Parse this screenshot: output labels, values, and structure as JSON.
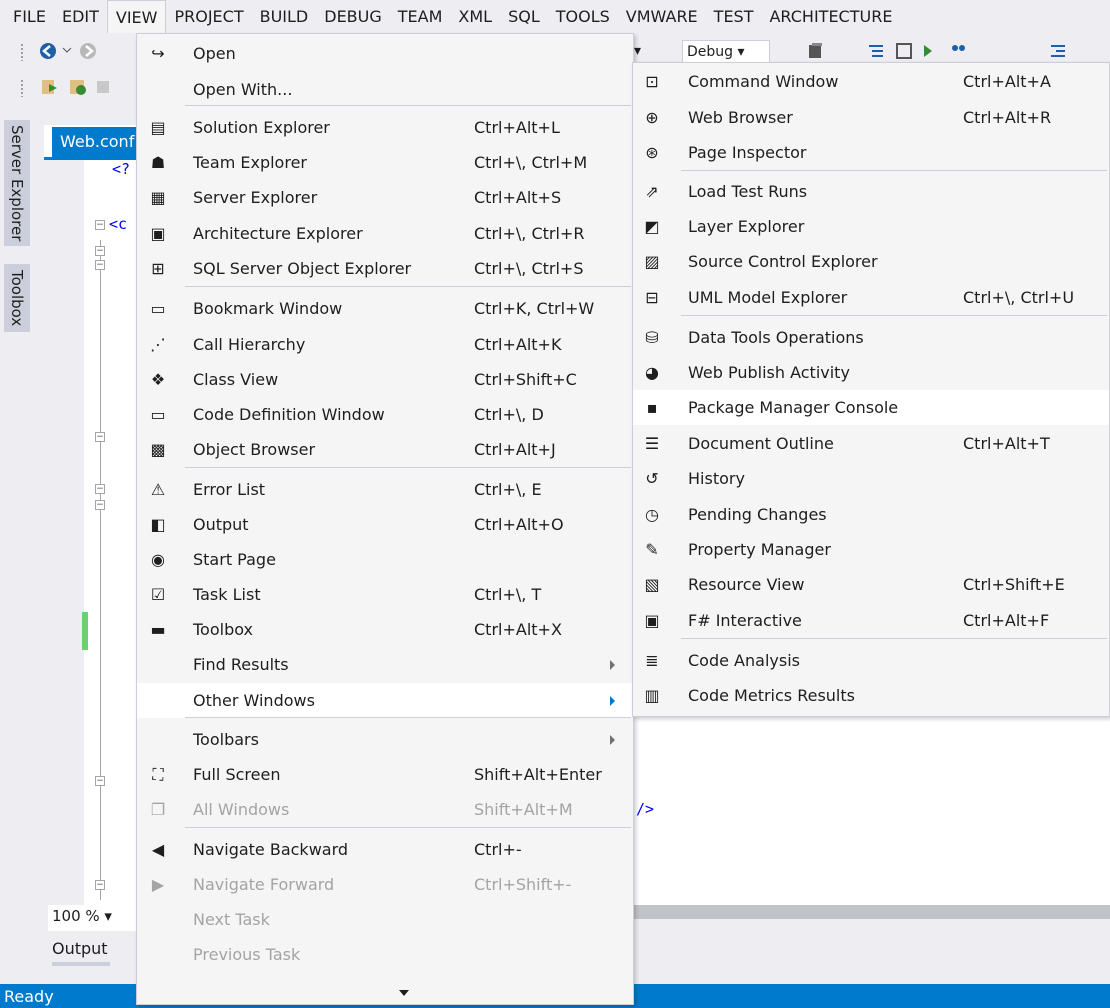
{
  "menubar": {
    "items": [
      "FILE",
      "EDIT",
      "VIEW",
      "PROJECT",
      "BUILD",
      "DEBUG",
      "TEAM",
      "XML",
      "SQL",
      "TOOLS",
      "VMWARE",
      "TEST",
      "ARCHITECTURE"
    ],
    "open_item": "VIEW"
  },
  "toolbar": {
    "config_value": "Debug"
  },
  "side_tabs": {
    "server_explorer": "Server Explorer",
    "toolbox": "Toolbox"
  },
  "editor": {
    "doc_tab": "Web.conf",
    "code_fragments": [
      "<?",
      "<c",
      "/>"
    ],
    "zoom": "100 %",
    "output_tab": "Output"
  },
  "status_bar": {
    "text": "Ready"
  },
  "view_menu": {
    "items": [
      {
        "icon": "open-icon",
        "glyph": "↪",
        "label": "Open",
        "shortcut": ""
      },
      {
        "icon": "",
        "glyph": "",
        "label": "Open With...",
        "shortcut": ""
      },
      {
        "icon": "solution-explorer-icon",
        "glyph": "▤",
        "label": "Solution Explorer",
        "shortcut": "Ctrl+Alt+L"
      },
      {
        "icon": "team-explorer-icon",
        "glyph": "☗",
        "label": "Team Explorer",
        "shortcut": "Ctrl+\\, Ctrl+M"
      },
      {
        "icon": "server-explorer-icon",
        "glyph": "▦",
        "label": "Server Explorer",
        "shortcut": "Ctrl+Alt+S"
      },
      {
        "icon": "architecture-explorer-icon",
        "glyph": "▣",
        "label": "Architecture Explorer",
        "shortcut": "Ctrl+\\, Ctrl+R"
      },
      {
        "icon": "sql-object-explorer-icon",
        "glyph": "⊞",
        "label": "SQL Server Object Explorer",
        "shortcut": "Ctrl+\\, Ctrl+S"
      },
      {
        "icon": "bookmark-icon",
        "glyph": "▭",
        "label": "Bookmark Window",
        "shortcut": "Ctrl+K, Ctrl+W"
      },
      {
        "icon": "call-hierarchy-icon",
        "glyph": "⋰",
        "label": "Call Hierarchy",
        "shortcut": "Ctrl+Alt+K"
      },
      {
        "icon": "class-view-icon",
        "glyph": "❖",
        "label": "Class View",
        "shortcut": "Ctrl+Shift+C"
      },
      {
        "icon": "code-definition-icon",
        "glyph": "▭",
        "label": "Code Definition Window",
        "shortcut": "Ctrl+\\, D"
      },
      {
        "icon": "object-browser-icon",
        "glyph": "▩",
        "label": "Object Browser",
        "shortcut": "Ctrl+Alt+J"
      },
      {
        "icon": "error-list-icon",
        "glyph": "⚠",
        "label": "Error List",
        "shortcut": "Ctrl+\\, E"
      },
      {
        "icon": "output-icon",
        "glyph": "◧",
        "label": "Output",
        "shortcut": "Ctrl+Alt+O"
      },
      {
        "icon": "start-page-icon",
        "glyph": "◉",
        "label": "Start Page",
        "shortcut": ""
      },
      {
        "icon": "task-list-icon",
        "glyph": "☑",
        "label": "Task List",
        "shortcut": "Ctrl+\\, T"
      },
      {
        "icon": "toolbox-icon",
        "glyph": "▬",
        "label": "Toolbox",
        "shortcut": "Ctrl+Alt+X"
      },
      {
        "icon": "",
        "glyph": "",
        "label": "Find Results",
        "shortcut": "",
        "submenu": true
      },
      {
        "icon": "",
        "glyph": "",
        "label": "Other Windows",
        "shortcut": "",
        "submenu": true,
        "highlighted": true
      },
      {
        "icon": "",
        "glyph": "",
        "label": "Toolbars",
        "shortcut": "",
        "submenu": true
      },
      {
        "icon": "full-screen-icon",
        "glyph": "⛶",
        "label": "Full Screen",
        "shortcut": "Shift+Alt+Enter"
      },
      {
        "icon": "all-windows-icon",
        "glyph": "❐",
        "label": "All Windows",
        "shortcut": "Shift+Alt+M",
        "disabled": true
      },
      {
        "icon": "navigate-backward-icon",
        "glyph": "◀",
        "label": "Navigate Backward",
        "shortcut": "Ctrl+-"
      },
      {
        "icon": "navigate-forward-icon",
        "glyph": "▶",
        "label": "Navigate Forward",
        "shortcut": "Ctrl+Shift+-",
        "disabled": true
      },
      {
        "icon": "",
        "glyph": "",
        "label": "Next Task",
        "shortcut": "",
        "disabled": true
      },
      {
        "icon": "",
        "glyph": "",
        "label": "Previous Task",
        "shortcut": "",
        "disabled": true
      }
    ]
  },
  "other_windows_menu": {
    "items": [
      {
        "icon": "command-window-icon",
        "glyph": "⊡",
        "label": "Command Window",
        "shortcut": "Ctrl+Alt+A"
      },
      {
        "icon": "web-browser-icon",
        "glyph": "⊕",
        "label": "Web Browser",
        "shortcut": "Ctrl+Alt+R"
      },
      {
        "icon": "page-inspector-icon",
        "glyph": "⊛",
        "label": "Page Inspector",
        "shortcut": ""
      },
      {
        "icon": "load-test-icon",
        "glyph": "⇗",
        "label": "Load Test Runs",
        "shortcut": ""
      },
      {
        "icon": "layer-explorer-icon",
        "glyph": "◩",
        "label": "Layer Explorer",
        "shortcut": ""
      },
      {
        "icon": "source-control-icon",
        "glyph": "▨",
        "label": "Source Control Explorer",
        "shortcut": ""
      },
      {
        "icon": "uml-explorer-icon",
        "glyph": "⊟",
        "label": "UML Model Explorer",
        "shortcut": "Ctrl+\\, Ctrl+U"
      },
      {
        "icon": "data-tools-icon",
        "glyph": "⛁",
        "label": "Data Tools Operations",
        "shortcut": ""
      },
      {
        "icon": "web-publish-icon",
        "glyph": "◕",
        "label": "Web Publish Activity",
        "shortcut": ""
      },
      {
        "icon": "package-console-icon",
        "glyph": "▪",
        "label": "Package Manager Console",
        "shortcut": "",
        "highlighted": true
      },
      {
        "icon": "document-outline-icon",
        "glyph": "☰",
        "label": "Document Outline",
        "shortcut": "Ctrl+Alt+T"
      },
      {
        "icon": "history-icon",
        "glyph": "↺",
        "label": "History",
        "shortcut": ""
      },
      {
        "icon": "pending-changes-icon",
        "glyph": "◷",
        "label": "Pending Changes",
        "shortcut": ""
      },
      {
        "icon": "property-manager-icon",
        "glyph": "✎",
        "label": "Property Manager",
        "shortcut": ""
      },
      {
        "icon": "resource-view-icon",
        "glyph": "▧",
        "label": "Resource View",
        "shortcut": "Ctrl+Shift+E"
      },
      {
        "icon": "fsharp-interactive-icon",
        "glyph": "▣",
        "label": "F# Interactive",
        "shortcut": "Ctrl+Alt+F"
      },
      {
        "icon": "code-analysis-icon",
        "glyph": "≣",
        "label": "Code Analysis",
        "shortcut": ""
      },
      {
        "icon": "code-metrics-icon",
        "glyph": "▥",
        "label": "Code Metrics Results",
        "shortcut": ""
      }
    ]
  }
}
